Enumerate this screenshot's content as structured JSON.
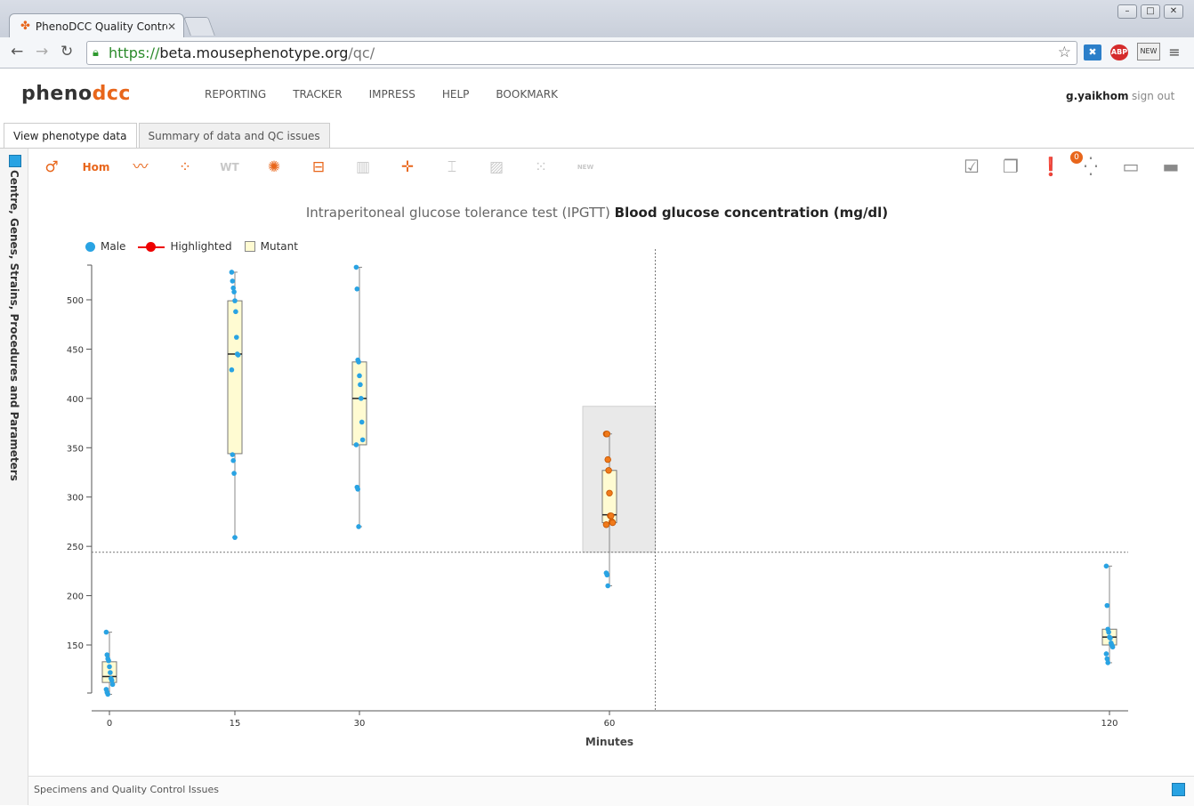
{
  "browser": {
    "tab_title": "PhenoDCC Quality Contro",
    "url_scheme": "https://",
    "url_host": "beta.mousephenotype.org",
    "url_path": "/qc/",
    "new_badge": "NEW",
    "abp_label": "ABP"
  },
  "header": {
    "logo_pheno": "pheno",
    "logo_dcc": "dcc",
    "nav": [
      "REPORTING",
      "TRACKER",
      "IMPRESS",
      "HELP",
      "BOOKMARK"
    ],
    "username": "g.yaikhom",
    "sign_out": "sign out"
  },
  "tabs": [
    {
      "label": "View phenotype data",
      "active": true
    },
    {
      "label": "Summary of data and QC issues",
      "active": false
    }
  ],
  "side_panel": {
    "label": "Centre, Genes, Strains, Procedures and Parameters"
  },
  "toolbar": {
    "gender_symbol": "♂",
    "hom_label": "Hom",
    "wt_label": "WT",
    "new_label": "NEW",
    "issue_count": "0"
  },
  "chart_data": {
    "type": "scatter",
    "title_procedure": "Intraperitoneal glucose tolerance test (IPGTT)",
    "title_parameter": "Blood glucose concentration (mg/dl)",
    "xlabel": "Minutes",
    "ylabel": "",
    "x_ticks": [
      0,
      15,
      30,
      60,
      120
    ],
    "y_ticks": [
      150,
      200,
      250,
      300,
      350,
      400,
      450,
      500
    ],
    "ylim": [
      80,
      535
    ],
    "legend": [
      "Male",
      "Highlighted",
      "Mutant"
    ],
    "colors": {
      "male": "#29a3e3",
      "highlighted": "#f07a1a",
      "box_fill": "#fffbd2"
    },
    "crosshair": {
      "x": 65.5,
      "y": 244
    },
    "selection": {
      "x0": 56.8,
      "x1": 65.5,
      "y0": 244,
      "y1": 392
    },
    "groups": [
      {
        "x": 0,
        "min": 100,
        "q1": 112,
        "median": 118,
        "q3": 133,
        "max": 163,
        "points": [
          163,
          140,
          136,
          134,
          128,
          122,
          116,
          114,
          110,
          105,
          102,
          100
        ],
        "highlighted": false
      },
      {
        "x": 15,
        "min": 259,
        "q1": 344,
        "median": 445,
        "q3": 499,
        "max": 528,
        "points": [
          528,
          519,
          512,
          508,
          499,
          488,
          462,
          445,
          444,
          429,
          343,
          337,
          324,
          259
        ],
        "highlighted": false
      },
      {
        "x": 30,
        "min": 270,
        "q1": 353,
        "median": 400,
        "q3": 437,
        "max": 533,
        "points": [
          533,
          511,
          439,
          437,
          423,
          414,
          400,
          376,
          358,
          353,
          310,
          308,
          270
        ],
        "highlighted": false
      },
      {
        "x": 60,
        "min": 210,
        "q1": 274,
        "median": 282,
        "q3": 327,
        "max": 364,
        "points": [
          364,
          364,
          338,
          327,
          304,
          281,
          281,
          275,
          274,
          272
        ],
        "highlighted": true
      },
      {
        "x": 60,
        "min": 210,
        "q1": 210,
        "median": 222,
        "q3": 223,
        "max": 223,
        "points": [
          223,
          221,
          210
        ],
        "highlighted": false,
        "no_box": true
      },
      {
        "x": 120,
        "min": 132,
        "q1": 150,
        "median": 158,
        "q3": 166,
        "max": 230,
        "points": [
          230,
          190,
          166,
          163,
          158,
          157,
          152,
          150,
          148,
          141,
          136,
          132
        ],
        "highlighted": false
      }
    ]
  },
  "footer": {
    "label": "Specimens and Quality Control Issues"
  }
}
